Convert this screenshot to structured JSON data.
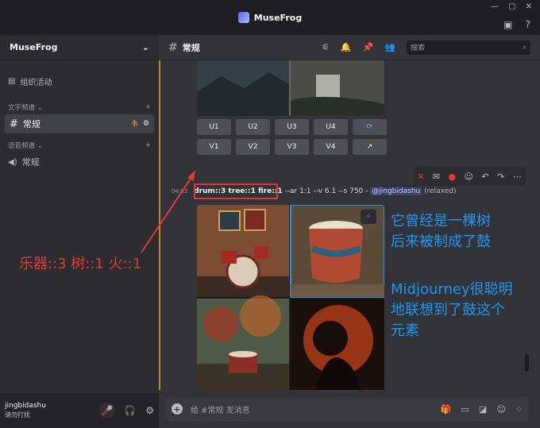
{
  "window": {
    "title": "MuseFrog",
    "controls": [
      "—",
      "▢",
      "✕"
    ]
  },
  "server": {
    "name": "MuseFrog"
  },
  "sidebar": {
    "events": "组织活动",
    "text_category": "文字频道",
    "text_channel": "常规",
    "voice_category": "语音频道",
    "voice_channel": "常规"
  },
  "user": {
    "name": "jingbidashu",
    "status": "请勿打扰"
  },
  "channel": {
    "name": "常规",
    "search_placeholder": "搜索"
  },
  "upscale_buttons": [
    "U1",
    "U2",
    "U3",
    "U4"
  ],
  "variation_buttons": [
    "V1",
    "V2",
    "V3",
    "V4"
  ],
  "message": {
    "time": "04:03",
    "prompt": "drum::3 tree::1 fire::1",
    "params": " --ar 1:1 --v 6.1 --s 750 - ",
    "mention": "@jingbidashu",
    "mode": " (relaxed)"
  },
  "annotations": {
    "red": "乐器::3 树::1 火::1",
    "blue_lines": [
      "它曾经是一棵树",
      "后来被制成了鼓",
      "",
      "Midjourney很聪明",
      "地联想到了鼓这个",
      "元素"
    ]
  },
  "composer": {
    "placeholder": "给 #常规 发消息"
  },
  "colors": {
    "accent_red": "#e53935",
    "accent_blue": "#2196f3",
    "new_marker": "#c08a2a"
  }
}
